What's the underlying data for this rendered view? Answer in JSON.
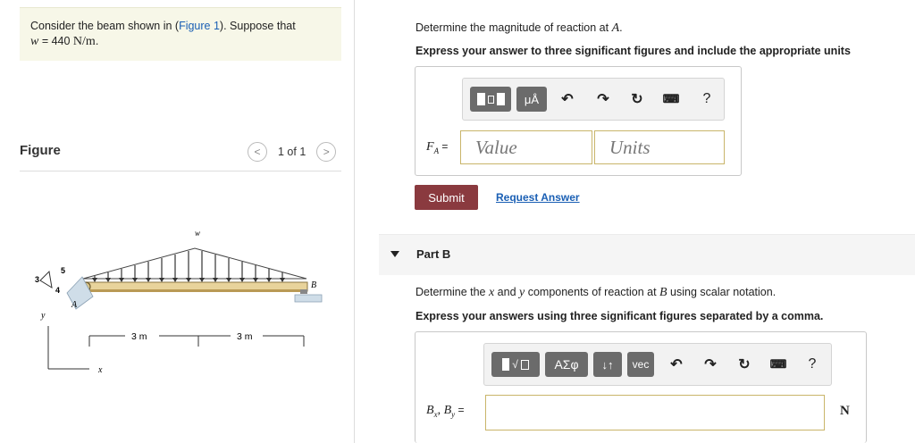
{
  "problem": {
    "text_before": "Consider the beam shown in (",
    "figure_link": "Figure 1",
    "text_after": "). Suppose that",
    "w_var": "w",
    "w_eq": " = 440 ",
    "w_unit": "N/m",
    "w_end": "."
  },
  "figure_panel": {
    "heading": "Figure",
    "pager_prev": "<",
    "pager_text": "1 of 1",
    "pager_next": ">",
    "labels": {
      "w": "w",
      "slope_a": "3",
      "slope_b": "4",
      "slope_c": "5",
      "A": "A",
      "B": "B",
      "y": "y",
      "x": "x",
      "dim1": "3 m",
      "dim2": "3 m"
    }
  },
  "part_a": {
    "question_prefix": "Determine the magnitude of reaction at ",
    "question_var": "A",
    "question_suffix": ".",
    "instructions": "Express your answer to three significant figures and include the appropriate units",
    "toolbar": {
      "units_btn": "μÅ",
      "help": "?"
    },
    "var_label": "F",
    "var_sub": "A",
    "var_eq": " =",
    "value_placeholder": "Value",
    "units_placeholder": "Units",
    "submit": "Submit",
    "request": "Request Answer"
  },
  "part_b": {
    "title": "Part B",
    "question_prefix": "Determine the ",
    "q_x": "x",
    "question_mid": " and ",
    "q_y": "y",
    "question_mid2": " components of reaction at ",
    "q_B": "B",
    "question_suffix": " using scalar notation.",
    "instructions": "Express your answers using three significant figures separated by a comma.",
    "toolbar": {
      "greek": "ΑΣφ",
      "arrows": "↓↑",
      "vec": "vec",
      "help": "?"
    },
    "var_label": "B",
    "var_sub1": "x",
    "var_sep": ", ",
    "var_label2": "B",
    "var_sub2": "y",
    "var_eq": " =",
    "unit": "N"
  }
}
